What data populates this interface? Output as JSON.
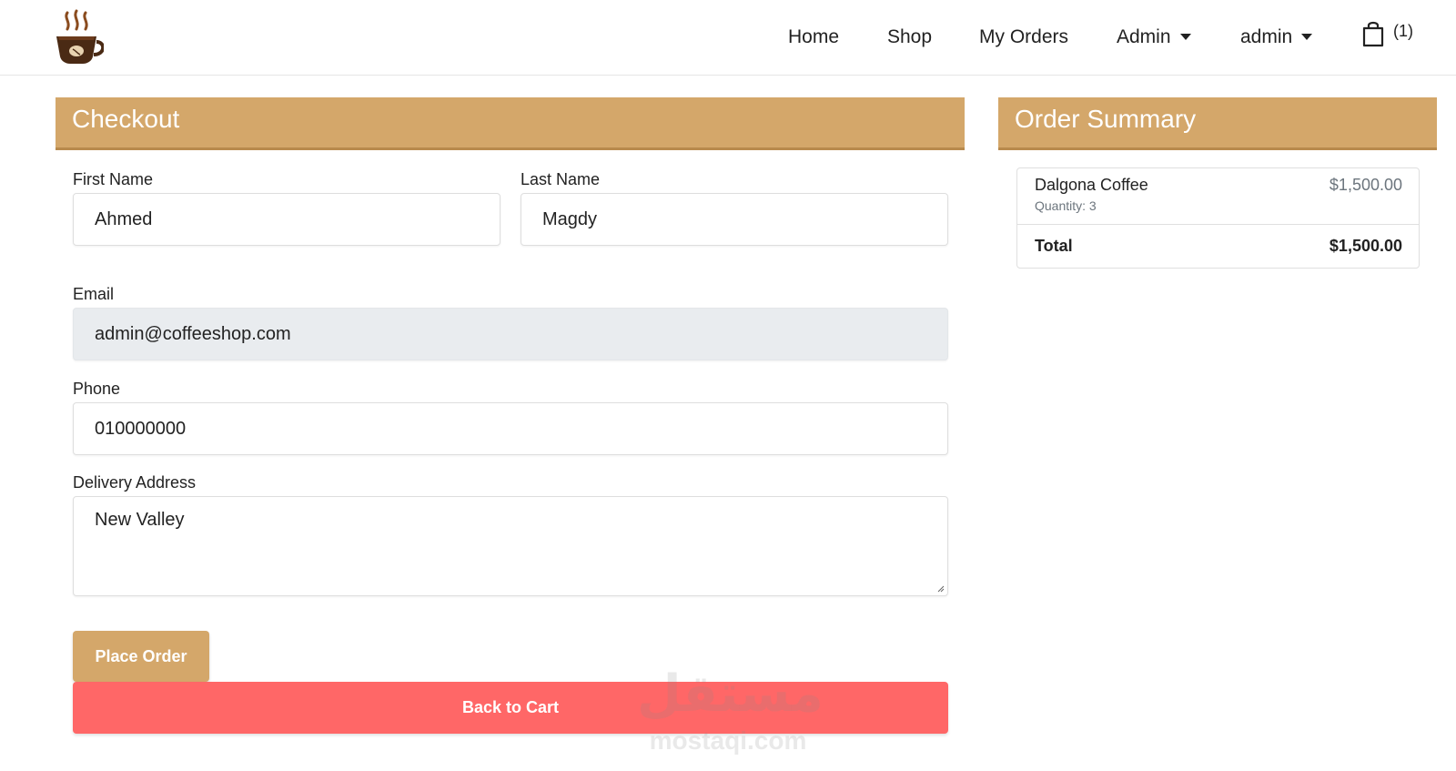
{
  "nav": {
    "home": "Home",
    "shop": "Shop",
    "my_orders": "My Orders",
    "admin_menu": "Admin",
    "user_menu": "admin",
    "cart_count": "(1)"
  },
  "checkout": {
    "title": "Checkout",
    "first_name_label": "First Name",
    "first_name_value": "Ahmed",
    "last_name_label": "Last Name",
    "last_name_value": "Magdy",
    "email_label": "Email",
    "email_value": "admin@coffeeshop.com",
    "phone_label": "Phone",
    "phone_value": "010000000",
    "address_label": "Delivery Address",
    "address_value": "New Valley",
    "place_order_label": "Place Order",
    "back_to_cart_label": "Back to Cart"
  },
  "summary": {
    "title": "Order Summary",
    "items": [
      {
        "name": "Dalgona Coffee",
        "quantity_text": "Quantity: 3",
        "price": "$1,500.00"
      }
    ],
    "total_label": "Total",
    "total_value": "$1,500.00"
  },
  "watermark": {
    "arabic": "مستقل",
    "latin": "mostaqi.com"
  },
  "colors": {
    "accent": "#d4a76a",
    "danger": "#ff6767",
    "disabled_field": "#e9ecef"
  },
  "icons": {
    "logo": "coffee-cup-logo-icon",
    "cart": "shopping-bag-icon",
    "dropdown": "caret-down-icon"
  }
}
